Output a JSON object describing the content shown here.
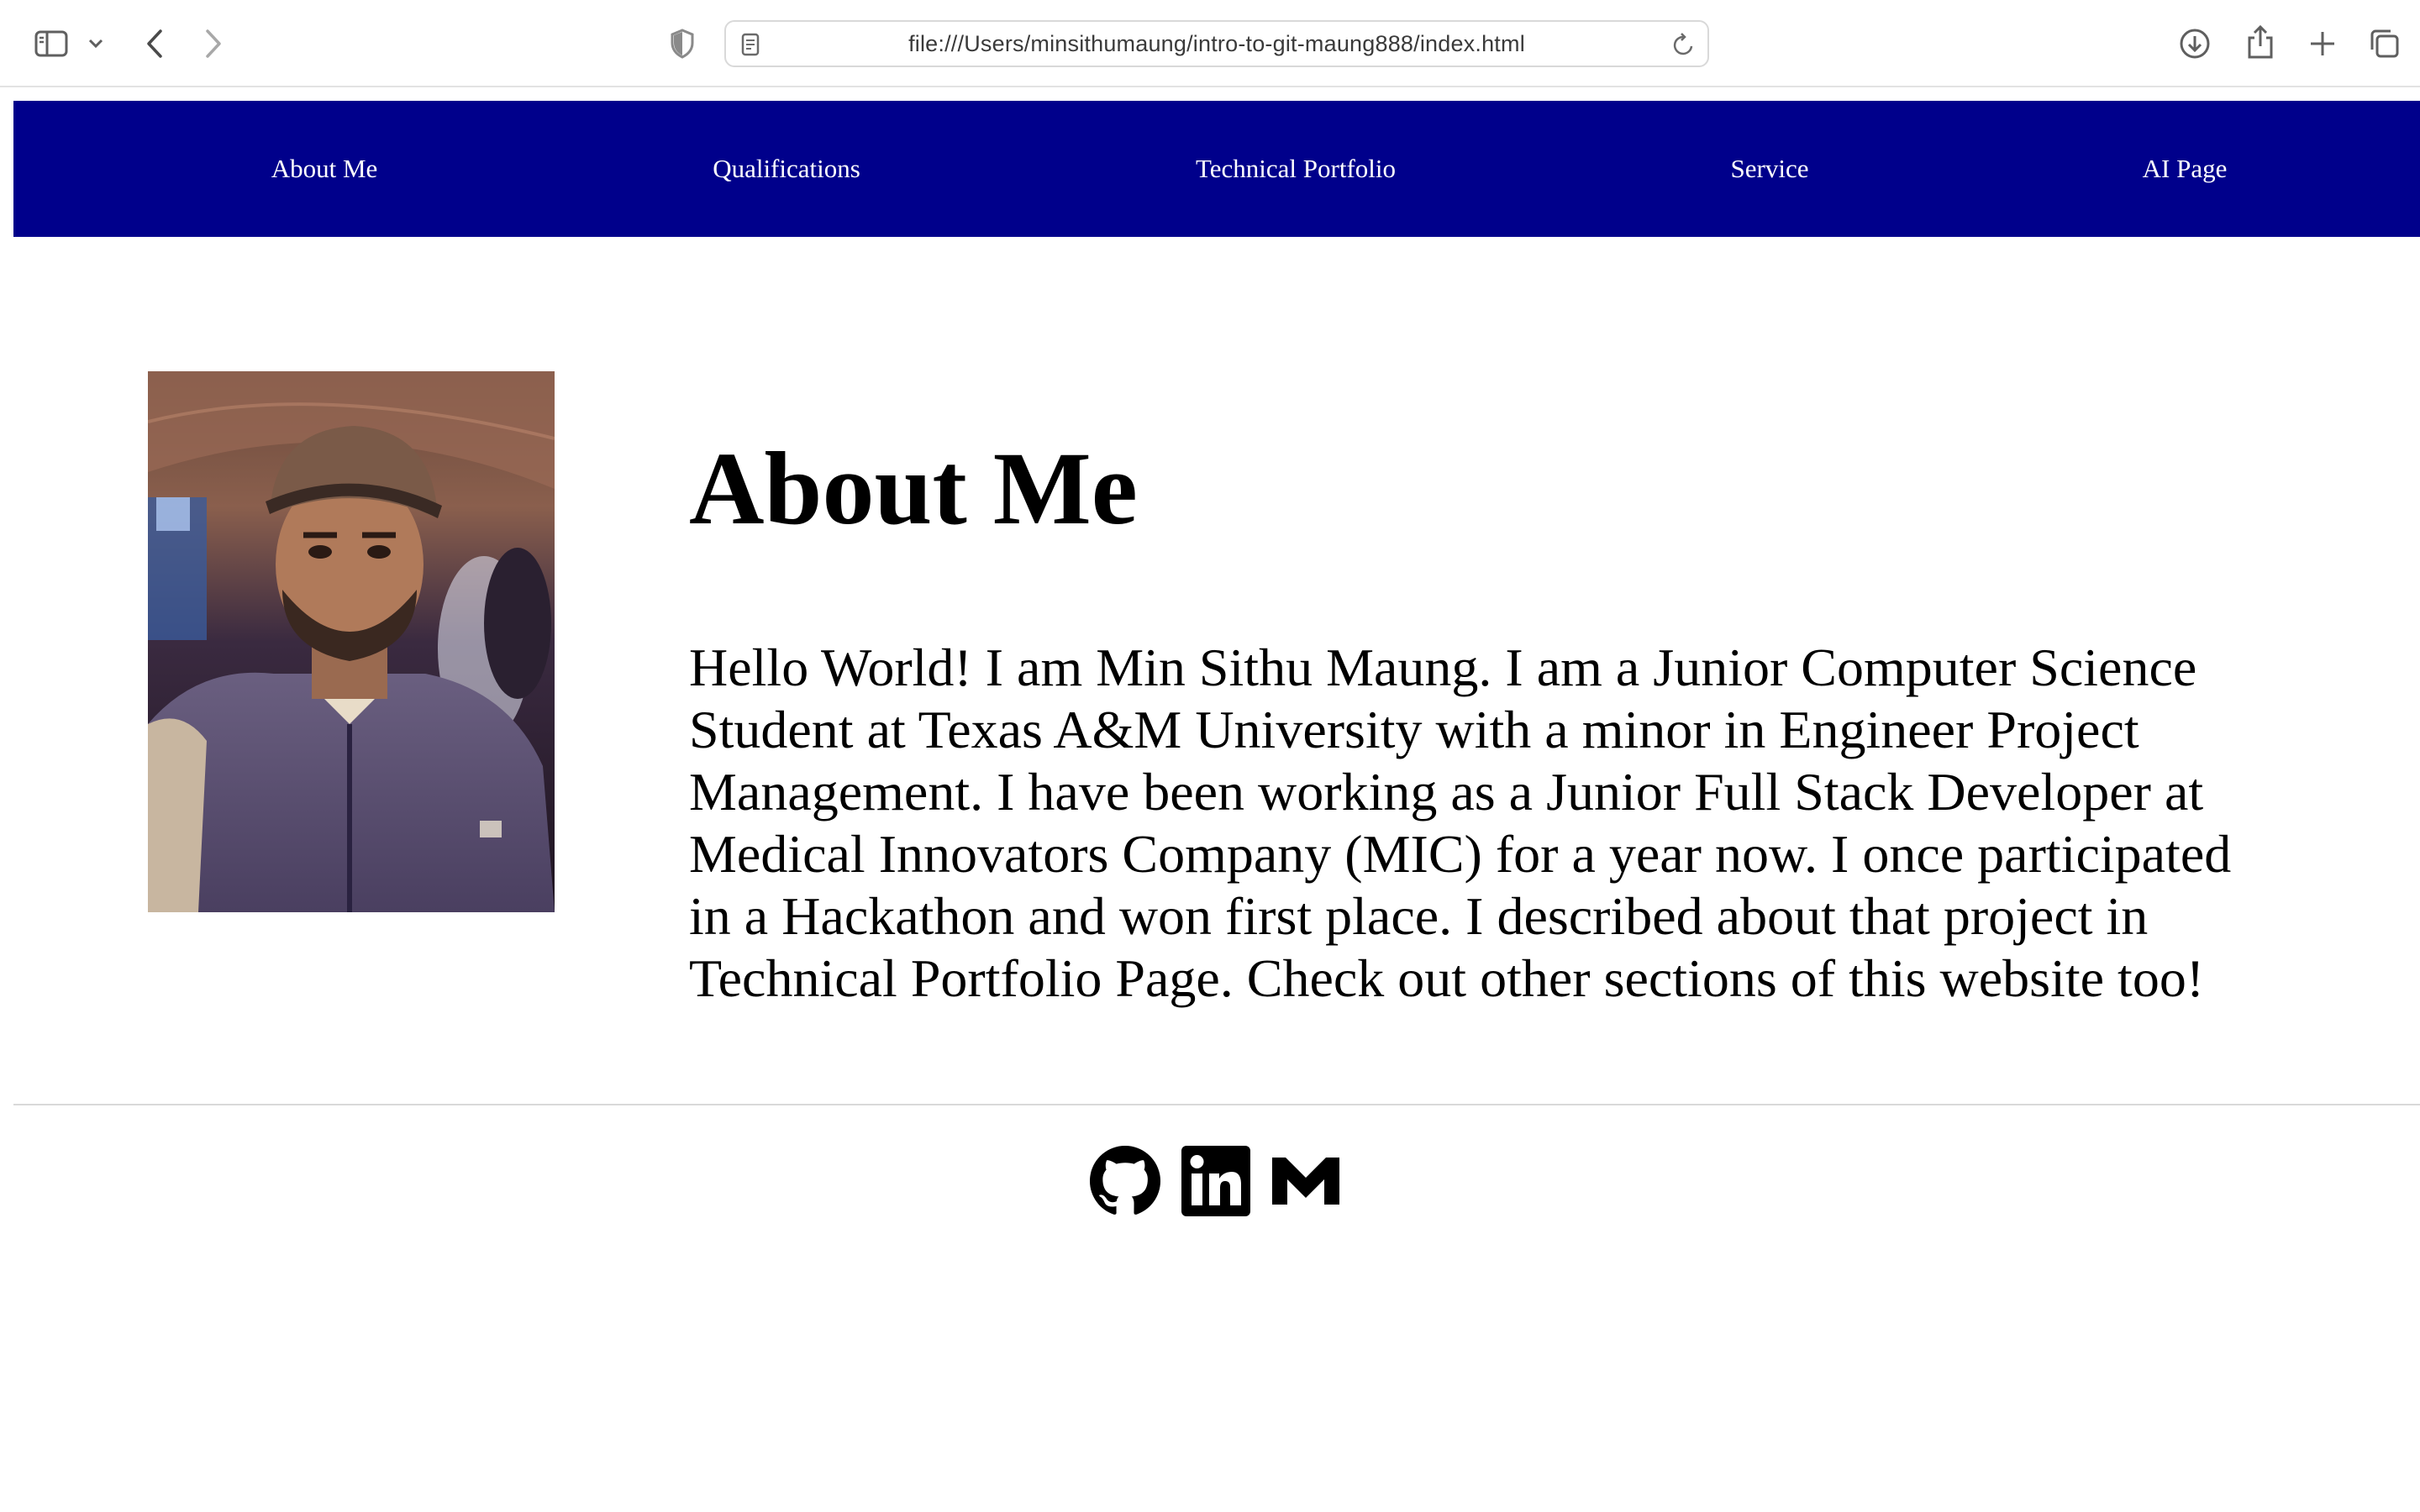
{
  "browser": {
    "url": "file:///Users/minsithumaung/intro-to-git-maung888/index.html",
    "icons": [
      "sidebar-icon",
      "chevron-down-icon",
      "back-icon",
      "forward-icon",
      "privacy-shield-icon",
      "page-icon",
      "reload-icon",
      "download-icon",
      "share-icon",
      "new-tab-icon",
      "tab-overview-icon"
    ]
  },
  "nav": {
    "background": "#00008b",
    "items": [
      {
        "label": "About Me"
      },
      {
        "label": "Qualifications"
      },
      {
        "label": "Technical Portfolio"
      },
      {
        "label": "Service"
      },
      {
        "label": "AI Page"
      }
    ]
  },
  "main": {
    "title": "About Me",
    "bio": "Hello World! I am Min Sithu Maung. I am a Junior Computer Science Student at Texas A&M University with a minor in Engineer Project Management. I have been working as a Junior Full Stack Developer at Medical Innovators Company (MIC) for a year now. I once participated in a Hackathon and won first place. I described about that project in Technical Portfolio Page. Check out other sections of this website too!"
  },
  "footer": {
    "social_icons": [
      "github-icon",
      "linkedin-icon",
      "gmail-icon"
    ]
  }
}
